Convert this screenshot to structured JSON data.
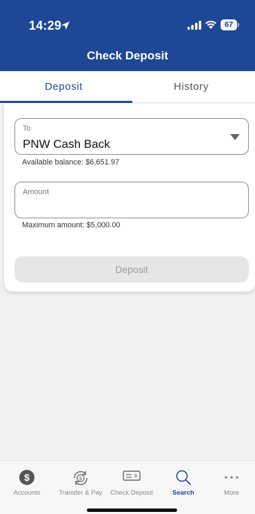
{
  "status": {
    "time": "14:29",
    "battery": "67"
  },
  "header": {
    "title": "Check Deposit"
  },
  "tabs": [
    {
      "label": "Deposit",
      "active": true
    },
    {
      "label": "History",
      "active": false
    }
  ],
  "form": {
    "to_label": "To",
    "to_value": "PNW Cash Back",
    "available_balance": "Available balance: $6,651.97",
    "amount_label": "Amount",
    "amount_value": "",
    "maximum_amount": "Maximum amount: $5,000.00",
    "deposit_button": "Deposit"
  },
  "bottom_nav": [
    {
      "label": "Accounts",
      "icon": "dollar-icon"
    },
    {
      "label": "Transfer & Pay",
      "icon": "transfer-icon"
    },
    {
      "label": "Check Deposit",
      "icon": "check-icon"
    },
    {
      "label": "Search",
      "icon": "search-icon",
      "active": true
    },
    {
      "label": "More",
      "icon": "more-icon"
    }
  ],
  "colors": {
    "brand": "#1e4796",
    "background": "#f2f2f2"
  }
}
